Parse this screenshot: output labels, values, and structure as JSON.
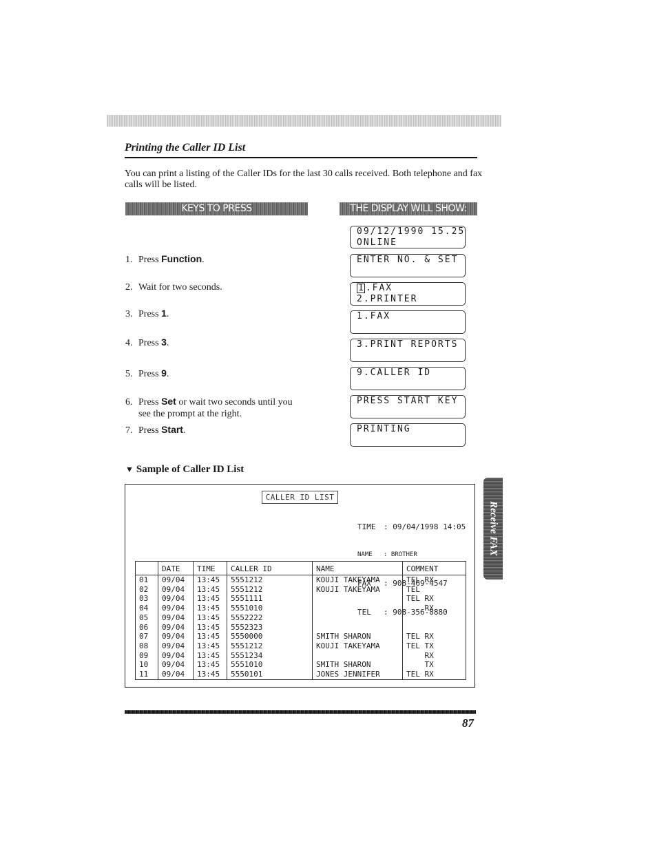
{
  "section": {
    "title": "Printing the Caller ID List",
    "intro": "You can print a listing of the Caller IDs for the last 30 calls received. Both telephone and fax calls will be listed."
  },
  "banners": {
    "keys": "KEYS TO PRESS",
    "display": "THE DISPLAY WILL SHOW:"
  },
  "steps": [
    {
      "num": "1.",
      "pre": "Press ",
      "key": "Function",
      "post": "."
    },
    {
      "num": "2.",
      "pre": "Wait for two seconds.",
      "key": "",
      "post": ""
    },
    {
      "num": "3.",
      "pre": "Press ",
      "key": "1",
      "post": "."
    },
    {
      "num": "4.",
      "pre": "Press ",
      "key": "3",
      "post": "."
    },
    {
      "num": "5.",
      "pre": "Press ",
      "key": "9",
      "post": "."
    },
    {
      "num": "6.",
      "pre": "Press ",
      "key": "Set",
      "post": " or wait two seconds until you",
      "cont": "see the prompt at the right."
    },
    {
      "num": "7.",
      "pre": "Press ",
      "key": "Start",
      "post": "."
    }
  ],
  "displays": [
    {
      "line1": "09/12/1990 15.25",
      "line2": "ONLINE"
    },
    {
      "line1": "ENTER NO. & SET",
      "line2": ""
    },
    {
      "line1_boxed": "1",
      "line1": ".FAX",
      "line2": "2.PRINTER"
    },
    {
      "line1": "1.FAX",
      "line2": ""
    },
    {
      "line1": "3.PRINT REPORTS",
      "line2": ""
    },
    {
      "line1": "9.CALLER ID",
      "line2": ""
    },
    {
      "line1": "PRESS START KEY",
      "line2": ""
    },
    {
      "line1": "PRINTING",
      "line2": ""
    }
  ],
  "sample": {
    "title": "Sample of Caller ID List",
    "list_title": "CALLER ID LIST",
    "meta": {
      "time_label": "TIME",
      "time_value": "09/04/1998 14:05",
      "name_label": "NAME",
      "name_value": "BROTHER",
      "fax_label": "FAX",
      "fax_value": "908-469-4547",
      "tel_label": "TEL",
      "tel_value": "908-356-8880"
    },
    "columns": [
      "",
      "DATE",
      "TIME",
      "CALLER ID",
      "NAME",
      "COMMENT"
    ],
    "rows": [
      [
        "01",
        "09/04",
        "13:45",
        "5551212",
        "KOUJI TAKEYAMA",
        "TEL RX"
      ],
      [
        "02",
        "09/04",
        "13:45",
        "5551212",
        "KOUJI TAKEYAMA",
        "TEL"
      ],
      [
        "03",
        "09/04",
        "13:45",
        "5551111",
        "",
        "TEL RX"
      ],
      [
        "04",
        "09/04",
        "13:45",
        "5551010",
        "",
        "    RX"
      ],
      [
        "05",
        "09/04",
        "13:45",
        "5552222",
        "",
        ""
      ],
      [
        "06",
        "09/04",
        "13:45",
        "5552323",
        "",
        ""
      ],
      [
        "07",
        "09/04",
        "13:45",
        "5550000",
        "SMITH SHARON",
        "TEL RX"
      ],
      [
        "08",
        "09/04",
        "13:45",
        "5551212",
        "KOUJI TAKEYAMA",
        "TEL TX"
      ],
      [
        "09",
        "09/04",
        "13:45",
        "5551234",
        "",
        "    RX"
      ],
      [
        "10",
        "09/04",
        "13:45",
        "5551010",
        "SMITH SHARON",
        "    TX"
      ],
      [
        "11",
        "09/04",
        "13:45",
        "5550101",
        "JONES JENNIFER",
        "TEL RX"
      ]
    ]
  },
  "side_tab": "Receive FAX",
  "page_number": "87"
}
